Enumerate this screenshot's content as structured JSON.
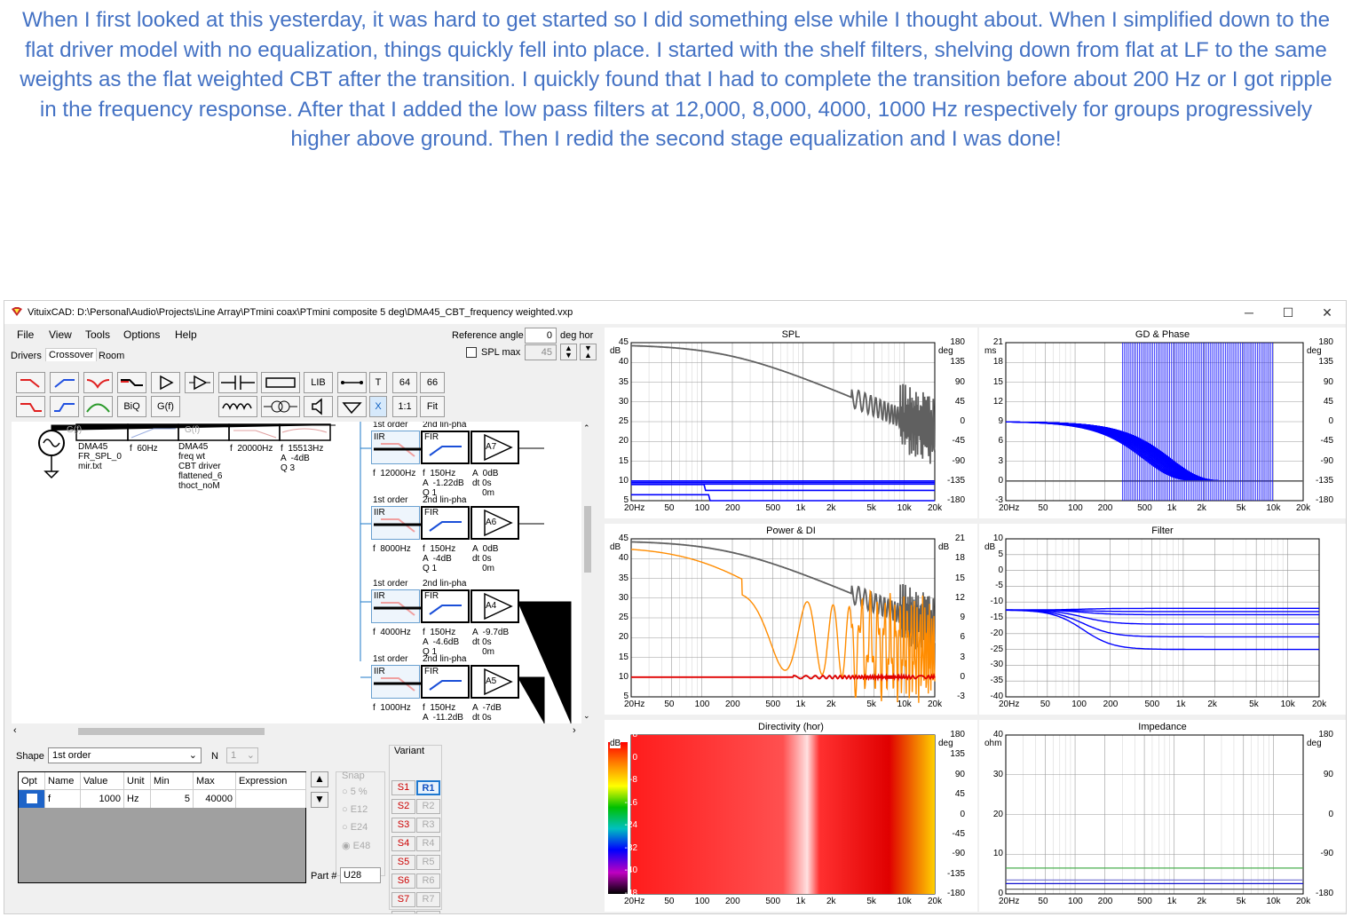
{
  "caption": "When I first looked at this yesterday, it was hard to get started so I did something else while I thought about.  When I simplified down to the flat driver model with no equalization, things quickly fell into place.  I started with the shelf filters, shelving down from flat at LF to the same weights as the flat weighted CBT after the transition.  I quickly found that I had to complete the transition before about 200 Hz or I got ripple in the frequency response.  After that I added the low pass filters at  12,000, 8,000, 4000, 1000 Hz respectively for groups progressively higher above ground.  Then I redid the second stage equalization and I was done!",
  "window": {
    "title": "VituixCAD: D:\\Personal\\Audio\\Projects\\Line Array\\PTmini coax\\PTmini composite 5 deg\\DMA45_CBT_frequency weighted.vxp",
    "min": "─",
    "max": "☐",
    "close": "✕"
  },
  "menu": [
    "File",
    "View",
    "Tools",
    "Options",
    "Help"
  ],
  "tabs": [
    "Drivers",
    "Crossover",
    "Room"
  ],
  "ref": {
    "label": "Reference angle",
    "value": "0",
    "unit": "deg hor",
    "splmax": "SPL max",
    "splval": "45"
  },
  "toolbar": {
    "lib": "LIB",
    "t": "T",
    "n64": "64",
    "n66": "66",
    "biq": "BiQ",
    "gf": "G(f)",
    "x": "X",
    "one": "1:1",
    "fit": "Fit"
  },
  "schematic": {
    "src1": "DMA45\nFR_SPL_0\nmir.txt",
    "f60": "f  60Hz",
    "src2": "DMA45\nfreq wt\nCBT driver\nflattened_6\nthoct_noM",
    "f20k": "f  20000Hz",
    "f15k": "f  15513Hz\nA  -4dB\nQ 3",
    "gf1": "G(f)",
    "gf2": "G(f)",
    "groups": [
      {
        "o1": "1st order",
        "o2": "2nd lin-pha",
        "iir": "IIR",
        "fir": "FIR",
        "amp": "A7",
        "lp": "f  12000Hz",
        "hp": "f  150Hz\nA  -1.22dB\nQ 1",
        "g": "A  0dB\ndt 0s\n    0m"
      },
      {
        "o1": "1st order",
        "o2": "2nd lin-pha",
        "iir": "IIR",
        "fir": "FIR",
        "amp": "A6",
        "lp": "f  8000Hz",
        "hp": "f  150Hz\nA  -4dB\nQ 1",
        "g": "A  0dB\ndt 0s\n    0m"
      },
      {
        "o1": "1st order",
        "o2": "2nd lin-pha",
        "iir": "IIR",
        "fir": "FIR",
        "amp": "A4",
        "lp": "f  4000Hz",
        "hp": "f  150Hz\nA  -4.6dB\nQ 1",
        "g": "A  -9.7dB\ndt 0s\n    0m"
      },
      {
        "o1": "1st order",
        "o2": "2nd lin-pha",
        "iir": "IIR",
        "fir": "FIR",
        "amp": "A5",
        "lp": "f  1000Hz",
        "hp": "f  150Hz\nA  -11.2dB",
        "g": "A  -7dB\ndt 0s"
      }
    ]
  },
  "shape": {
    "label": "Shape",
    "value": "1st order",
    "n": "N",
    "nval": "1"
  },
  "params": {
    "headers": [
      "Opt",
      "Name",
      "Value",
      "Unit",
      "Min",
      "Max",
      "Expression"
    ],
    "row": [
      "",
      "f",
      "1000",
      "Hz",
      "5",
      "40000",
      ""
    ]
  },
  "snap": {
    "label": "Snap",
    "opts": [
      "5 %",
      "E12",
      "E24",
      "E48"
    ]
  },
  "variant": {
    "label": "Variant",
    "s": [
      "S1",
      "S2",
      "S3",
      "S4",
      "S5",
      "S6",
      "S7",
      "S8"
    ],
    "r": [
      "R1",
      "R2",
      "R3",
      "R4",
      "R5",
      "R6",
      "R7",
      "R8"
    ]
  },
  "part": {
    "label": "Part #",
    "value": "U28"
  },
  "colors": {
    "blue": "#0000ff",
    "gray": "#606060",
    "orange": "#ff8c00",
    "red": "#e00000",
    "green": "#4caf50"
  },
  "charts": [
    {
      "title": "SPL",
      "yl": [
        "45",
        "40",
        "35",
        "30",
        "25",
        "20",
        "15",
        "10",
        "5"
      ],
      "yu": "dB",
      "yr": [
        "180",
        "135",
        "90",
        "45",
        "0",
        "-45",
        "-90",
        "-135",
        "-180"
      ],
      "yru": "deg",
      "x": [
        "20Hz",
        "50",
        "100",
        "200",
        "500",
        "1k",
        "2k",
        "5k",
        "10k",
        "20k"
      ]
    },
    {
      "title": "GD & Phase",
      "yl": [
        "21",
        "18",
        "15",
        "12",
        "9",
        "6",
        "3",
        "0",
        "-3"
      ],
      "yu": "ms",
      "yr": [
        "180",
        "135",
        "90",
        "45",
        "0",
        "-45",
        "-90",
        "-135",
        "-180"
      ],
      "yru": "deg",
      "x": [
        "20Hz",
        "50",
        "100",
        "200",
        "500",
        "1k",
        "2k",
        "5k",
        "10k",
        "20k"
      ]
    },
    {
      "title": "Power & DI",
      "yl": [
        "45",
        "40",
        "35",
        "30",
        "25",
        "20",
        "15",
        "10",
        "5"
      ],
      "yu": "dB",
      "yr": [
        "21",
        "18",
        "15",
        "12",
        "9",
        "6",
        "3",
        "0",
        "-3"
      ],
      "yru": "dB",
      "x": [
        "20Hz",
        "50",
        "100",
        "200",
        "500",
        "1k",
        "2k",
        "5k",
        "10k",
        "20k"
      ]
    },
    {
      "title": "Filter",
      "yl": [
        "10",
        "5",
        "0",
        "-5",
        "-10",
        "-15",
        "-20",
        "-25",
        "-30",
        "-35",
        "-40"
      ],
      "yu": "dB",
      "yr": [],
      "yru": "",
      "x": [
        "20Hz",
        "50",
        "100",
        "200",
        "500",
        "1k",
        "2k",
        "5k",
        "10k",
        "20k"
      ]
    },
    {
      "title": "Directivity (hor)",
      "yl": [
        "8",
        "0",
        "-8",
        "-16",
        "-24",
        "-32",
        "-40",
        "-48"
      ],
      "yu": "dB",
      "yr": [
        "180",
        "135",
        "90",
        "45",
        "0",
        "-45",
        "-90",
        "-135",
        "-180"
      ],
      "yru": "deg",
      "x": [
        "20Hz",
        "50",
        "100",
        "200",
        "500",
        "1k",
        "2k",
        "5k",
        "10k",
        "20k"
      ]
    },
    {
      "title": "Impedance",
      "yl": [
        "40",
        "30",
        "20",
        "10",
        "0"
      ],
      "yu": "ohm",
      "yr": [
        "180",
        "90",
        "0",
        "-90",
        "-180"
      ],
      "yru": "deg",
      "x": [
        "20Hz",
        "50",
        "100",
        "200",
        "500",
        "1k",
        "2k",
        "5k",
        "10k",
        "20k"
      ]
    }
  ]
}
